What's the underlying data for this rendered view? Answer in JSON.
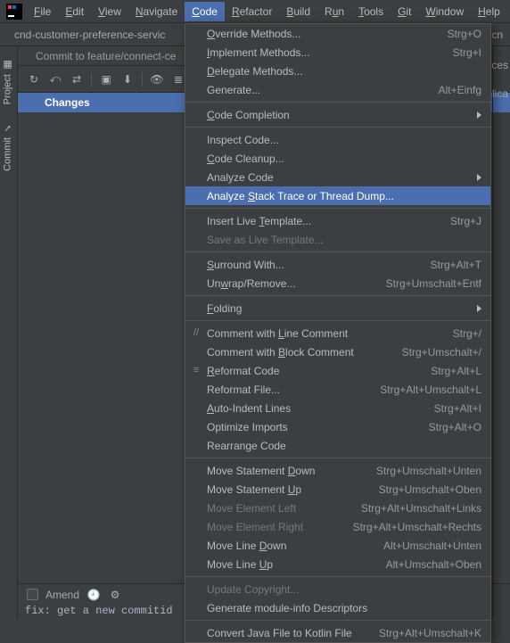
{
  "app_logo": "IJ",
  "menubar": [
    {
      "label": "File",
      "m": "F"
    },
    {
      "label": "Edit",
      "m": "E"
    },
    {
      "label": "View",
      "m": "V"
    },
    {
      "label": "Navigate",
      "m": "N"
    },
    {
      "label": "Code",
      "m": "C"
    },
    {
      "label": "Refactor",
      "m": "R"
    },
    {
      "label": "Build",
      "m": "B"
    },
    {
      "label": "Run",
      "m": "u"
    },
    {
      "label": "Tools",
      "m": "T"
    },
    {
      "label": "Git",
      "m": "G"
    },
    {
      "label": "Window",
      "m": "W"
    },
    {
      "label": "Help",
      "m": "H"
    }
  ],
  "open_menu_index": 4,
  "tabbar": {
    "tab1": "cnd-customer-preference-servic",
    "tab2": "cn"
  },
  "subbar_text": "Commit to feature/connect-ce",
  "sidetabs": {
    "project": "Project",
    "commit": "Commit"
  },
  "changes_label": "Changes",
  "amend_label": "Amend",
  "commit_msg": "fix: get a new commitid",
  "right_truncated": {
    "urces": "urces",
    "plica": "plica"
  },
  "dropdown": [
    {
      "label": "Override Methods...",
      "m": "O",
      "shortcut": "Strg+O"
    },
    {
      "label": "Implement Methods...",
      "m": "I",
      "shortcut": "Strg+I"
    },
    {
      "label": "Delegate Methods...",
      "m": "D"
    },
    {
      "label": "Generate...",
      "m": "",
      "shortcut": "Alt+Einfg"
    },
    {
      "sep": true
    },
    {
      "label": "Code Completion",
      "m": "C",
      "submenu": true
    },
    {
      "sep": true
    },
    {
      "label": "Inspect Code...",
      "m": ""
    },
    {
      "label": "Code Cleanup...",
      "m": "C"
    },
    {
      "label": "Analyze Code",
      "m": "",
      "submenu": true
    },
    {
      "label": "Analyze Stack Trace or Thread Dump...",
      "m": "S",
      "highlight": true
    },
    {
      "sep": true
    },
    {
      "label": "Insert Live Template...",
      "m": "T",
      "shortcut": "Strg+J"
    },
    {
      "label": "Save as Live Template...",
      "m": "",
      "disabled": true
    },
    {
      "sep": true
    },
    {
      "label": "Surround With...",
      "m": "S",
      "shortcut": "Strg+Alt+T"
    },
    {
      "label": "Unwrap/Remove...",
      "m": "w",
      "shortcut": "Strg+Umschalt+Entf"
    },
    {
      "sep": true
    },
    {
      "label": "Folding",
      "m": "F",
      "submenu": true
    },
    {
      "sep": true
    },
    {
      "label": "Comment with Line Comment",
      "m": "L",
      "shortcut": "Strg+/",
      "icon": "line-comment-icon"
    },
    {
      "label": "Comment with Block Comment",
      "m": "B",
      "shortcut": "Strg+Umschalt+/"
    },
    {
      "label": "Reformat Code",
      "m": "R",
      "shortcut": "Strg+Alt+L",
      "icon": "reformat-icon"
    },
    {
      "label": "Reformat File...",
      "m": "",
      "shortcut": "Strg+Alt+Umschalt+L"
    },
    {
      "label": "Auto-Indent Lines",
      "m": "A",
      "shortcut": "Strg+Alt+I"
    },
    {
      "label": "Optimize Imports",
      "m": "",
      "shortcut": "Strg+Alt+O"
    },
    {
      "label": "Rearrange Code",
      "m": ""
    },
    {
      "sep": true
    },
    {
      "label": "Move Statement Down",
      "m": "D",
      "shortcut": "Strg+Umschalt+Unten"
    },
    {
      "label": "Move Statement Up",
      "m": "U",
      "shortcut": "Strg+Umschalt+Oben"
    },
    {
      "label": "Move Element Left",
      "m": "",
      "shortcut": "Strg+Alt+Umschalt+Links",
      "disabled": true
    },
    {
      "label": "Move Element Right",
      "m": "",
      "shortcut": "Strg+Alt+Umschalt+Rechts",
      "disabled": true
    },
    {
      "label": "Move Line Down",
      "m": "D",
      "shortcut": "Alt+Umschalt+Unten"
    },
    {
      "label": "Move Line Up",
      "m": "U",
      "shortcut": "Alt+Umschalt+Oben"
    },
    {
      "sep": true
    },
    {
      "label": "Update Copyright...",
      "m": "",
      "disabled": true
    },
    {
      "label": "Generate module-info Descriptors",
      "m": ""
    },
    {
      "sep": true
    },
    {
      "label": "Convert Java File to Kotlin File",
      "m": "",
      "shortcut": "Strg+Alt+Umschalt+K"
    }
  ]
}
